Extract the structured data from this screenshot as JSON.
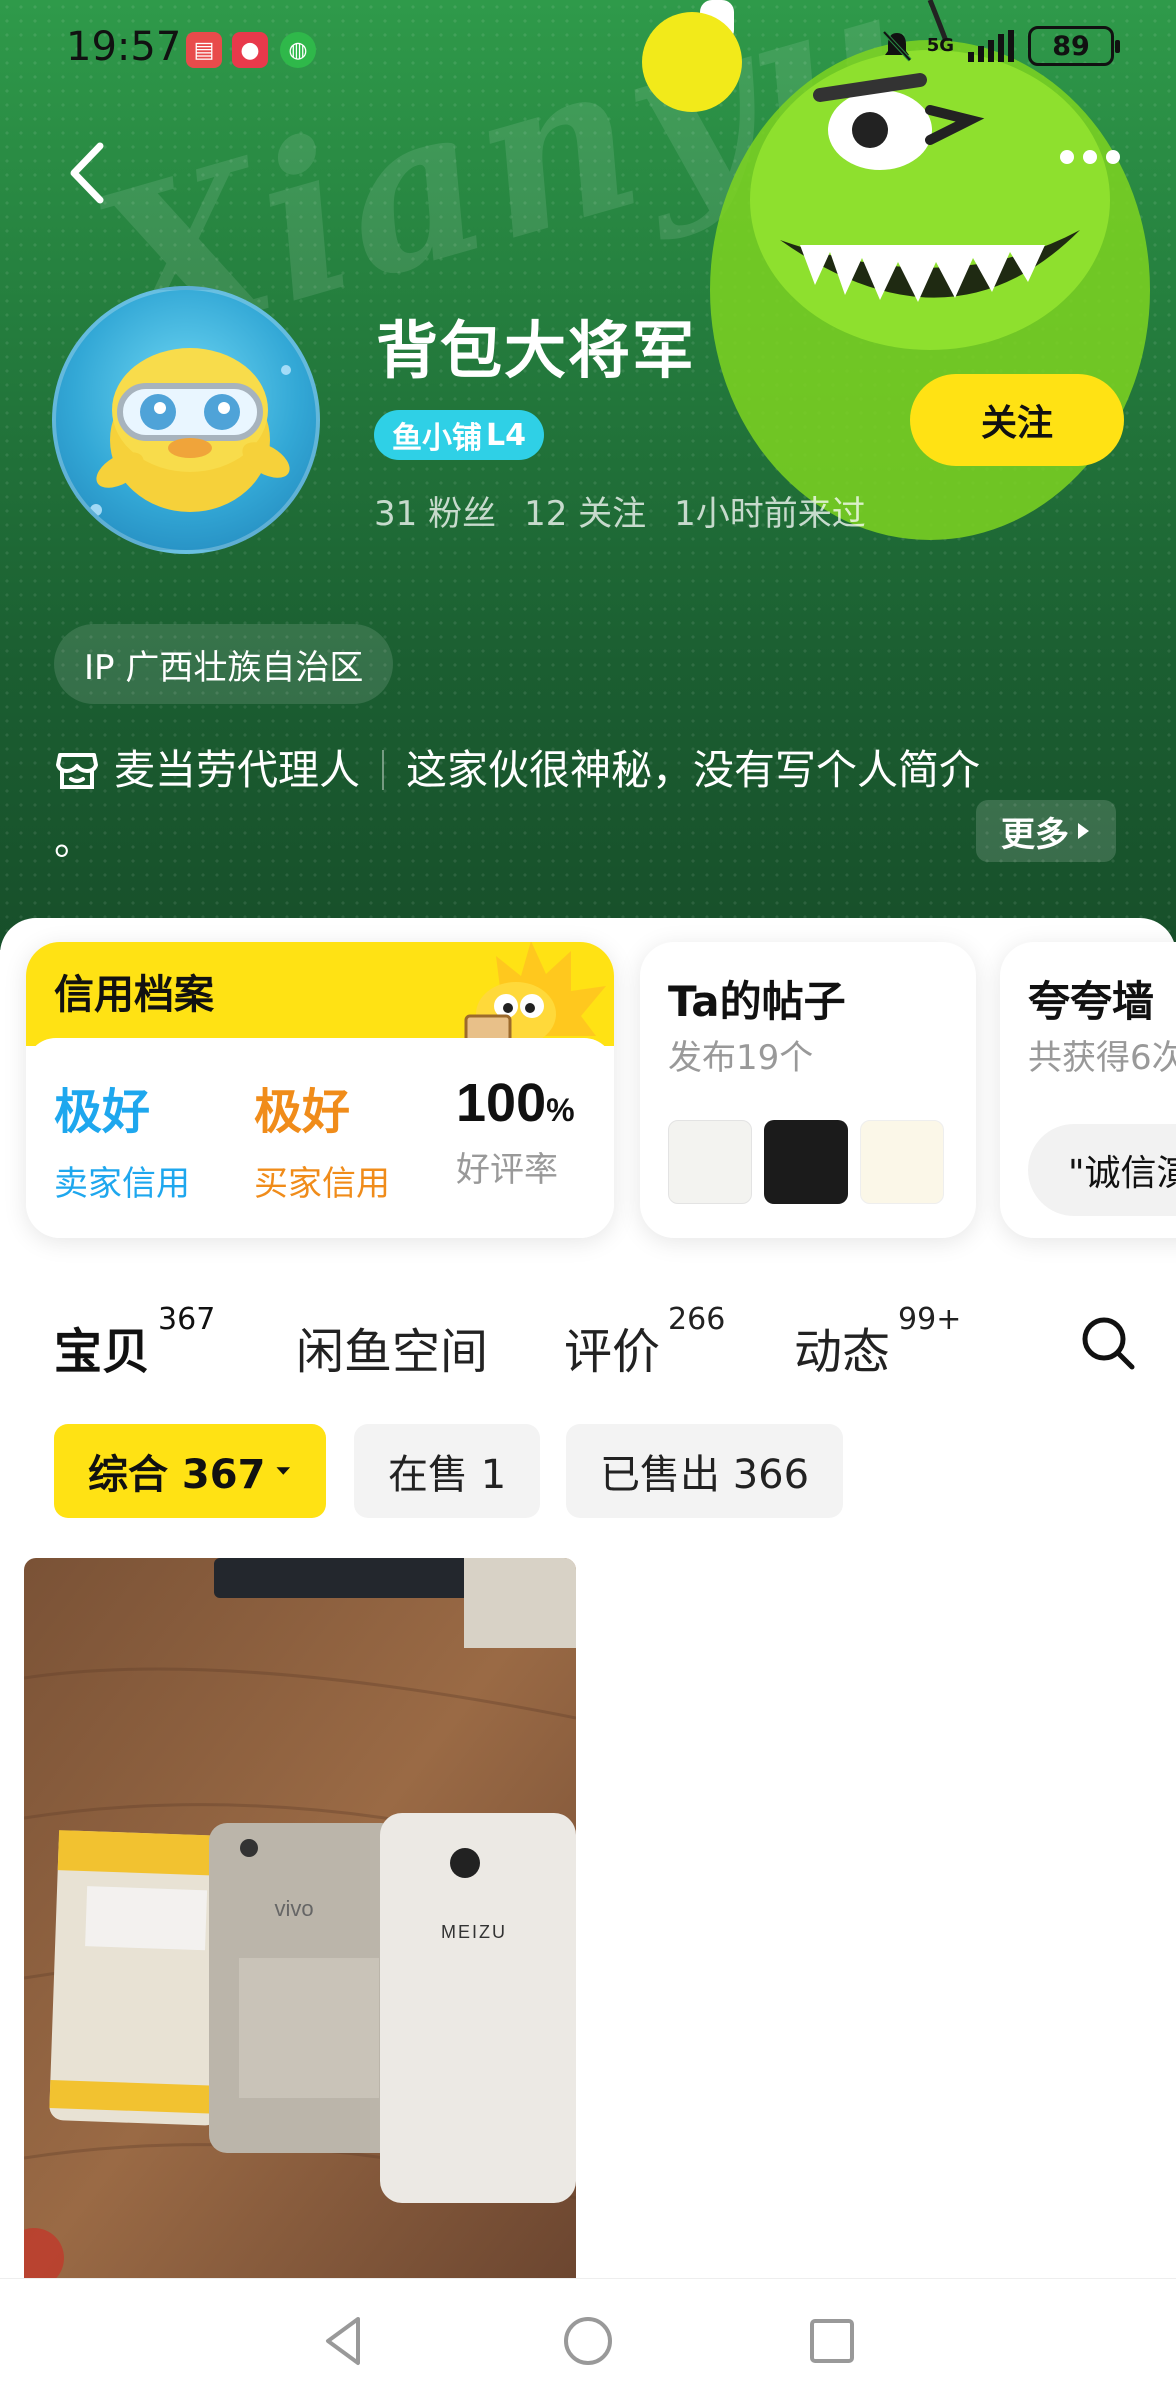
{
  "status_bar": {
    "time": "19:57",
    "network": "5G",
    "battery": "89"
  },
  "profile": {
    "name": "背包大将军",
    "badge_prefix": "鱼小铺",
    "badge_level": "L4",
    "follow_label": "关注",
    "fans": "31 粉丝",
    "following": "12 关注",
    "last_seen": "1小时前来过",
    "ip": "IP 广西壮族自治区",
    "role": "麦当劳代理人",
    "intro": "这家伙很神秘，没有写个人简介",
    "intro_tail": "。",
    "more_label": "更多"
  },
  "credit": {
    "title": "信用档案",
    "seller_value": "极好",
    "seller_label": "卖家信用",
    "buyer_value": "极好",
    "buyer_label": "买家信用",
    "rate_value": "100",
    "rate_unit": "%",
    "rate_label": "好评率"
  },
  "posts": {
    "title": "Ta的帖子",
    "subtitle": "发布19个"
  },
  "wall": {
    "title": "夸夸墙",
    "subtitle": "共获得6次",
    "pill": "\"诚信演"
  },
  "tabs": [
    {
      "label": "宝贝",
      "count": "367"
    },
    {
      "label": "闲鱼空间",
      "count": ""
    },
    {
      "label": "评价",
      "count": "266"
    },
    {
      "label": "动态",
      "count": "99+"
    }
  ],
  "filters": [
    {
      "label": "综合 367"
    },
    {
      "label": "在售 1"
    },
    {
      "label": "已售出 366"
    }
  ],
  "product": {
    "phone_brand_1": "vivo",
    "phone_brand_2": "MEIZU"
  },
  "colors": {
    "accent_yellow": "#ffe214",
    "header_green": "#247c3d",
    "badge_cyan": "#2fd0e6",
    "seller_blue": "#1ea7ee",
    "buyer_orange": "#f08c1a"
  }
}
